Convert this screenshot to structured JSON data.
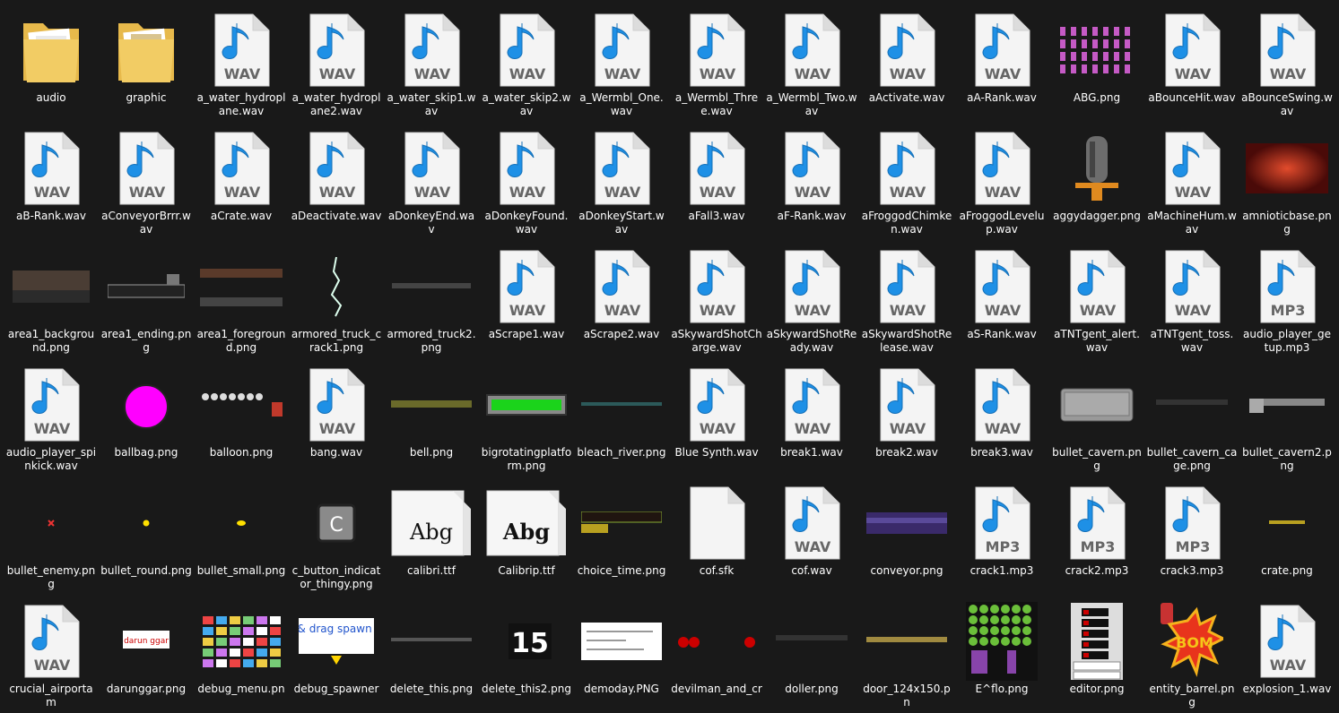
{
  "window": {
    "background": "#191919",
    "text_color": "#ffffff",
    "accent_note_color": "#1e90e6"
  },
  "files": [
    {
      "name": "audio",
      "icon": "folder-icon"
    },
    {
      "name": "graphic",
      "icon": "folder-icon"
    },
    {
      "name": "a_water_hydroplane.wav",
      "icon": "wav-icon",
      "badge": "WAV"
    },
    {
      "name": "a_water_hydroplane2.wav",
      "icon": "wav-icon",
      "badge": "WAV"
    },
    {
      "name": "a_water_skip1.wav",
      "icon": "wav-icon",
      "badge": "WAV"
    },
    {
      "name": "a_water_skip2.wav",
      "icon": "wav-icon",
      "badge": "WAV"
    },
    {
      "name": "a_Wermbl_One.wav",
      "icon": "wav-icon",
      "badge": "WAV"
    },
    {
      "name": "a_Wermbl_Three.wav",
      "icon": "wav-icon",
      "badge": "WAV"
    },
    {
      "name": "a_Wermbl_Two.wav",
      "icon": "wav-icon",
      "badge": "WAV"
    },
    {
      "name": "aActivate.wav",
      "icon": "wav-icon",
      "badge": "WAV"
    },
    {
      "name": "aA-Rank.wav",
      "icon": "wav-icon",
      "badge": "WAV"
    },
    {
      "name": "ABG.png",
      "icon": "image-thumbnail-icon"
    },
    {
      "name": "aBounceHit.wav",
      "icon": "wav-icon",
      "badge": "WAV"
    },
    {
      "name": "aBounceSwing.wav",
      "icon": "wav-icon",
      "badge": "WAV"
    },
    {
      "name": "aB-Rank.wav",
      "icon": "wav-icon",
      "badge": "WAV"
    },
    {
      "name": "aConveyorBrrr.wav",
      "icon": "wav-icon",
      "badge": "WAV"
    },
    {
      "name": "aCrate.wav",
      "icon": "wav-icon",
      "badge": "WAV"
    },
    {
      "name": "aDeactivate.wav",
      "icon": "wav-icon",
      "badge": "WAV"
    },
    {
      "name": "aDonkeyEnd.wav",
      "icon": "wav-icon",
      "badge": "WAV"
    },
    {
      "name": "aDonkeyFound.wav",
      "icon": "wav-icon",
      "badge": "WAV"
    },
    {
      "name": "aDonkeyStart.wav",
      "icon": "wav-icon",
      "badge": "WAV"
    },
    {
      "name": "aFall3.wav",
      "icon": "wav-icon",
      "badge": "WAV"
    },
    {
      "name": "aF-Rank.wav",
      "icon": "wav-icon",
      "badge": "WAV"
    },
    {
      "name": "aFroggodChimken.wav",
      "icon": "wav-icon",
      "badge": "WAV"
    },
    {
      "name": "aFroggodLevelup.wav",
      "icon": "wav-icon",
      "badge": "WAV"
    },
    {
      "name": "aggydagger.png",
      "icon": "image-thumbnail-icon"
    },
    {
      "name": "aMachineHum.wav",
      "icon": "wav-icon",
      "badge": "WAV"
    },
    {
      "name": "amnioticbase.png",
      "icon": "image-thumbnail-icon"
    },
    {
      "name": "area1_background.png",
      "icon": "image-thumbnail-icon"
    },
    {
      "name": "area1_ending.png",
      "icon": "image-thumbnail-icon"
    },
    {
      "name": "area1_foreground.png",
      "icon": "image-thumbnail-icon"
    },
    {
      "name": "armored_truck_crack1.png",
      "icon": "image-thumbnail-icon"
    },
    {
      "name": "armored_truck2.png",
      "icon": "image-thumbnail-icon"
    },
    {
      "name": "aScrape1.wav",
      "icon": "wav-icon",
      "badge": "WAV"
    },
    {
      "name": "aScrape2.wav",
      "icon": "wav-icon",
      "badge": "WAV"
    },
    {
      "name": "aSkywardShotCharge.wav",
      "icon": "wav-icon",
      "badge": "WAV"
    },
    {
      "name": "aSkywardShotReady.wav",
      "icon": "wav-icon",
      "badge": "WAV"
    },
    {
      "name": "aSkywardShotRelease.wav",
      "icon": "wav-icon",
      "badge": "WAV"
    },
    {
      "name": "aS-Rank.wav",
      "icon": "wav-icon",
      "badge": "WAV"
    },
    {
      "name": "aTNTgent_alert.wav",
      "icon": "wav-icon",
      "badge": "WAV"
    },
    {
      "name": "aTNTgent_toss.wav",
      "icon": "wav-icon",
      "badge": "WAV"
    },
    {
      "name": "audio_player_getup.mp3",
      "icon": "mp3-icon",
      "badge": "MP3"
    },
    {
      "name": "audio_player_spinkick.wav",
      "icon": "wav-icon",
      "badge": "WAV"
    },
    {
      "name": "ballbag.png",
      "icon": "image-thumbnail-icon"
    },
    {
      "name": "balloon.png",
      "icon": "image-thumbnail-icon"
    },
    {
      "name": "bang.wav",
      "icon": "wav-icon",
      "badge": "WAV"
    },
    {
      "name": "bell.png",
      "icon": "image-thumbnail-icon"
    },
    {
      "name": "bigrotatingplatform.png",
      "icon": "image-thumbnail-icon"
    },
    {
      "name": "bleach_river.png",
      "icon": "image-thumbnail-icon"
    },
    {
      "name": "Blue Synth.wav",
      "icon": "wav-icon",
      "badge": "WAV"
    },
    {
      "name": "break1.wav",
      "icon": "wav-icon",
      "badge": "WAV"
    },
    {
      "name": "break2.wav",
      "icon": "wav-icon",
      "badge": "WAV"
    },
    {
      "name": "break3.wav",
      "icon": "wav-icon",
      "badge": "WAV"
    },
    {
      "name": "bullet_cavern.png",
      "icon": "image-thumbnail-icon"
    },
    {
      "name": "bullet_cavern_cage.png",
      "icon": "image-thumbnail-icon"
    },
    {
      "name": "bullet_cavern2.png",
      "icon": "image-thumbnail-icon"
    },
    {
      "name": "bullet_enemy.png",
      "icon": "image-thumbnail-icon"
    },
    {
      "name": "bullet_round.png",
      "icon": "image-thumbnail-icon"
    },
    {
      "name": "bullet_small.png",
      "icon": "image-thumbnail-icon"
    },
    {
      "name": "c_button_indicator_thingy.png",
      "icon": "image-thumbnail-icon",
      "badge": "C"
    },
    {
      "name": "calibri.ttf",
      "icon": "font-file-icon",
      "badge": "Abg"
    },
    {
      "name": "Calibrip.ttf",
      "icon": "font-file-icon",
      "badge": "Abg"
    },
    {
      "name": "choice_time.png",
      "icon": "image-thumbnail-icon"
    },
    {
      "name": "cof.sfk",
      "icon": "blank-file-icon"
    },
    {
      "name": "cof.wav",
      "icon": "wav-icon",
      "badge": "WAV"
    },
    {
      "name": "conveyor.png",
      "icon": "image-thumbnail-icon"
    },
    {
      "name": "crack1.mp3",
      "icon": "mp3-icon",
      "badge": "MP3"
    },
    {
      "name": "crack2.mp3",
      "icon": "mp3-icon",
      "badge": "MP3"
    },
    {
      "name": "crack3.mp3",
      "icon": "mp3-icon",
      "badge": "MP3"
    },
    {
      "name": "crate.png",
      "icon": "image-thumbnail-icon"
    },
    {
      "name": "crucial_airportam",
      "icon": "wav-icon",
      "badge": "WAV"
    },
    {
      "name": "darunggar.png",
      "icon": "image-thumbnail-icon",
      "badge": "darun ggar"
    },
    {
      "name": "debug_menu.pn",
      "icon": "image-thumbnail-icon"
    },
    {
      "name": "debug_spawner",
      "icon": "image-thumbnail-icon",
      "badge": "click & drag spawn point"
    },
    {
      "name": "delete_this.png",
      "icon": "image-thumbnail-icon"
    },
    {
      "name": "delete_this2.png",
      "icon": "image-thumbnail-icon",
      "badge": "15"
    },
    {
      "name": "demoday.PNG",
      "icon": "image-thumbnail-icon"
    },
    {
      "name": "devilman_and_cr",
      "icon": "image-thumbnail-icon"
    },
    {
      "name": "doller.png",
      "icon": "image-thumbnail-icon"
    },
    {
      "name": "door_124x150.pn",
      "icon": "image-thumbnail-icon"
    },
    {
      "name": "E^flo.png",
      "icon": "image-thumbnail-icon"
    },
    {
      "name": "editor.png",
      "icon": "image-thumbnail-icon",
      "badge": "place current",
      "badge2": "write all to disk"
    },
    {
      "name": "entity_barrel.png",
      "icon": "image-thumbnail-icon",
      "badge": "BOM"
    },
    {
      "name": "explosion_1.wav",
      "icon": "wav-icon",
      "badge": "WAV"
    }
  ]
}
